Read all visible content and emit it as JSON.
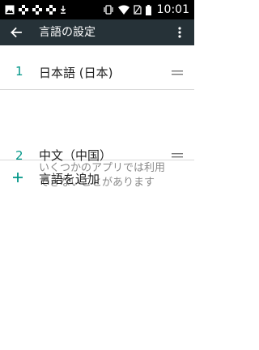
{
  "status_bar": {
    "time": "10:01",
    "left_icons": [
      "photo-icon",
      "checker-icon",
      "checker-icon",
      "checker-icon",
      "download-icon"
    ],
    "right_icons": [
      "vibrate-icon",
      "wifi-icon",
      "no-sim-icon",
      "battery-icon"
    ]
  },
  "app_bar": {
    "title": "言語の設定",
    "back_icon": "arrow-back-icon",
    "menu_icon": "more-vert-icon",
    "background": "#263238"
  },
  "languages": [
    {
      "index": "1",
      "name": "日本語 (日本)",
      "subtitle": ""
    },
    {
      "index": "2",
      "name": "中文（中国）",
      "subtitle": "いくつかのアプリでは利用できないことがあります"
    }
  ],
  "add_language": {
    "label": "言語を追加",
    "icon": "plus-icon"
  },
  "colors": {
    "accent": "#009688",
    "divider": "#dadada",
    "text_primary": "#212121",
    "text_secondary": "#8a8a8a"
  }
}
